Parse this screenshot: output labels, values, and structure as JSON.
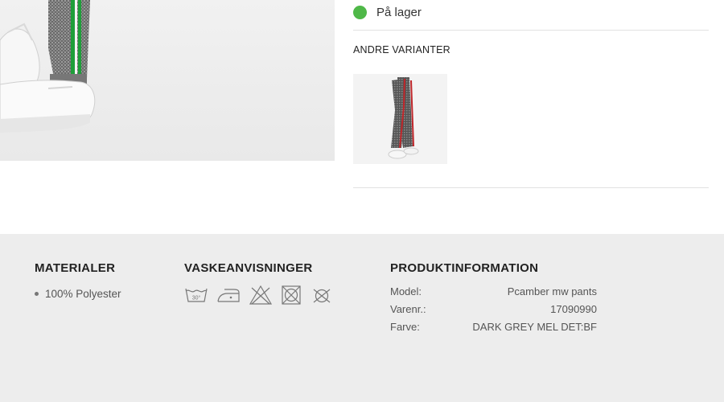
{
  "stock": {
    "label": "På lager",
    "status_color": "#4fb848"
  },
  "variants": {
    "title": "ANDRE VARIANTER",
    "thumbnail_icon": "pants-variant-thumbnail"
  },
  "details": {
    "materials": {
      "title": "MATERIALER",
      "items": [
        "100% Polyester"
      ]
    },
    "care": {
      "title": "VASKEANVISNINGER",
      "icons": [
        "wash-30-icon",
        "iron-low-icon",
        "no-bleach-icon",
        "no-tumble-dry-icon",
        "no-dry-clean-icon"
      ],
      "wash_temp_label": "30°"
    },
    "product_info": {
      "title": "PRODUKTINFORMATION",
      "rows": [
        {
          "label": "Model:",
          "value": "Pcamber mw pants"
        },
        {
          "label": "Varenr.:",
          "value": "17090990"
        },
        {
          "label": "Farve:",
          "value": "DARK GREY MEL DET:BF"
        }
      ]
    }
  }
}
